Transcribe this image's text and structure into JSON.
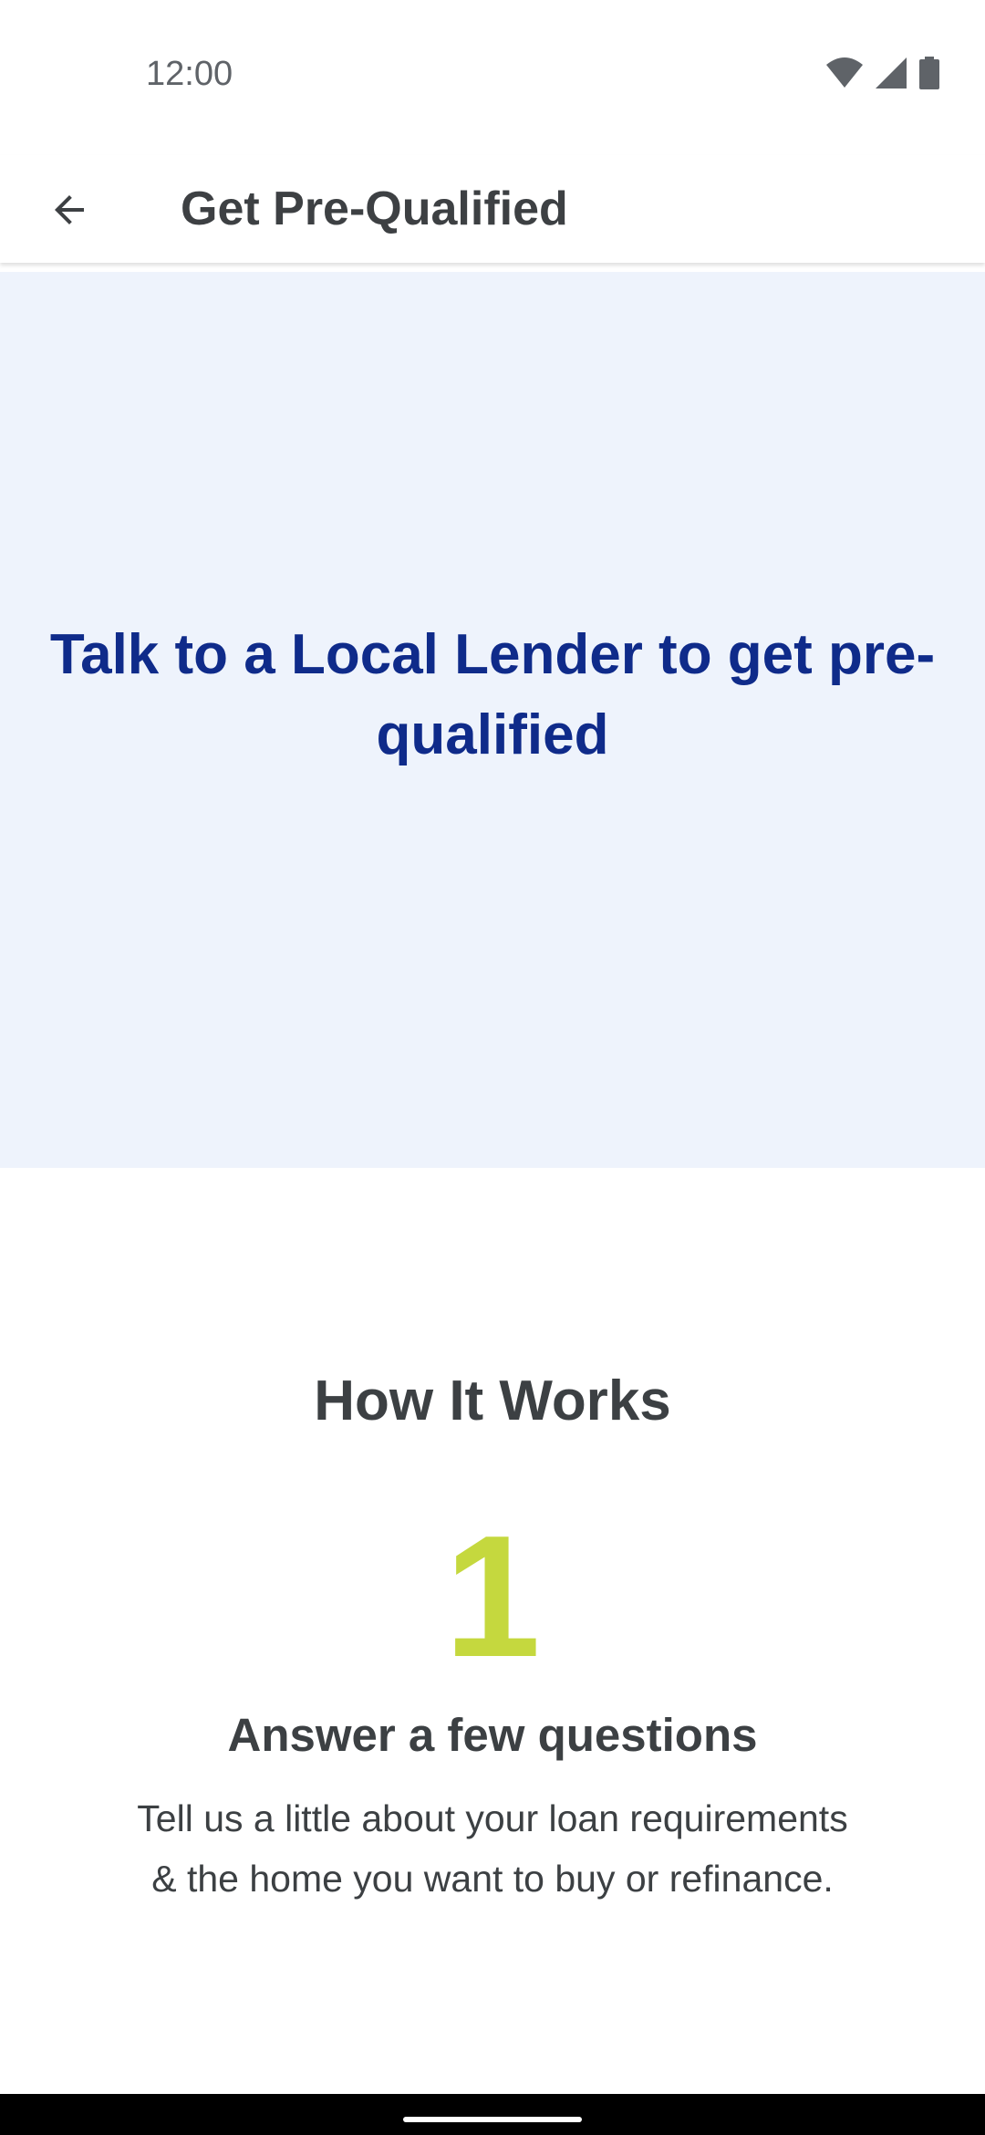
{
  "status_bar": {
    "time": "12:00"
  },
  "app_bar": {
    "title": "Get Pre-Qualified",
    "back_icon": "arrow-back-icon"
  },
  "hero": {
    "title": "Talk to a Local Lender to get pre-qualified",
    "background": "#eef3fc",
    "text_color": "#0f2b8a"
  },
  "how_it_works": {
    "title": "How It Works",
    "step": {
      "number": "1",
      "title": "Answer a few questions",
      "description": "Tell us a little about your loan requirements & the home you want to buy or refinance.",
      "number_color": "#c5d83e"
    }
  }
}
